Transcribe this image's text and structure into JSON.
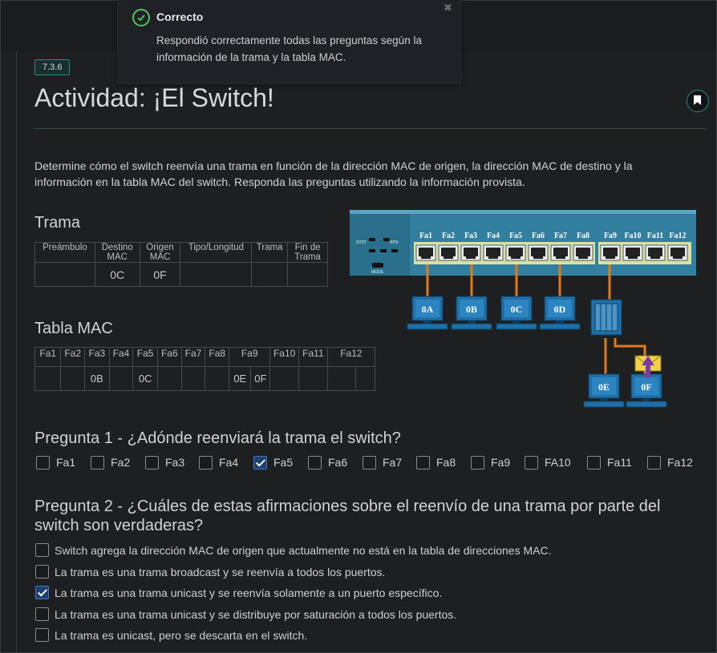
{
  "toast": {
    "title": "Correcto",
    "body": "Respondió correctamente todas las preguntas según la información de la trama y la tabla MAC."
  },
  "badge": "7.3.6",
  "title": "Actividad: ¡El Switch!",
  "description": "Determine cómo el switch reenvía una trama en función de la dirección MAC de origen, la dirección MAC de destino y la información en la tabla MAC del switch. Responda las preguntas utilizando la información provista.",
  "trama": {
    "heading": "Trama",
    "headers": [
      "Preámbulo",
      "Destino MAC",
      "Origen MAC",
      "Tipo/Longitud",
      "Trama",
      "Fin de Trama"
    ],
    "values": [
      "",
      "0C",
      "0F",
      "",
      "",
      ""
    ]
  },
  "mac_table": {
    "heading": "Tabla MAC",
    "headers": [
      "Fa1",
      "Fa2",
      "Fa3",
      "Fa4",
      "Fa5",
      "Fa6",
      "Fa7",
      "Fa8",
      "Fa9",
      "Fa10",
      "Fa11",
      "Fa12"
    ],
    "values": [
      "",
      "",
      "0B",
      "",
      "0C",
      "",
      "",
      "",
      "0E",
      "0F",
      "",
      "",
      "",
      ""
    ]
  },
  "diagram": {
    "ports": [
      "Fa1",
      "Fa2",
      "Fa3",
      "Fa4",
      "Fa5",
      "Fa6",
      "Fa7",
      "Fa8",
      "Fa9",
      "Fa10",
      "Fa11",
      "Fa12"
    ],
    "hosts": [
      "0A",
      "0B",
      "0C",
      "0D",
      "0E",
      "0F"
    ],
    "panel_labels": [
      "SYST",
      "RPS",
      "MODE"
    ],
    "colors": {
      "switch": "#2f7a9a",
      "host": "#1f6fa8",
      "cable": "#e07b1a",
      "arrow": "#7a3aa8",
      "envelope": "#f0d34a"
    }
  },
  "q1": {
    "number": "Pregunta 1",
    "text": "¿Adónde reenviará la trama el switch?",
    "options": [
      {
        "label": "Fa1",
        "checked": false
      },
      {
        "label": "Fa2",
        "checked": false
      },
      {
        "label": "Fa3",
        "checked": false
      },
      {
        "label": "Fa4",
        "checked": false
      },
      {
        "label": "Fa5",
        "checked": true
      },
      {
        "label": "Fa6",
        "checked": false
      },
      {
        "label": "Fa7",
        "checked": false
      },
      {
        "label": "Fa8",
        "checked": false
      },
      {
        "label": "Fa9",
        "checked": false
      },
      {
        "label": "FA10",
        "checked": false
      },
      {
        "label": "Fa11",
        "checked": false
      },
      {
        "label": "Fa12",
        "checked": false
      }
    ]
  },
  "q2": {
    "number": "Pregunta 2",
    "text": "¿Cuáles de estas afirmaciones sobre el reenvío de una trama por parte del switch son verdaderas?",
    "options": [
      {
        "label": "Switch agrega la dirección MAC de origen que actualmente no está en la tabla de direcciones MAC.",
        "checked": false
      },
      {
        "label": "La trama es una trama broadcast y se reenvía a todos los puertos.",
        "checked": false
      },
      {
        "label": "La trama es una trama unicast y se reenvía solamente a un puerto específico.",
        "checked": true
      },
      {
        "label": "La trama es una trama unicast y se distribuye por saturación a todos los puertos.",
        "checked": false
      },
      {
        "label": "La trama es unicast, pero se descarta en el switch.",
        "checked": false
      }
    ]
  }
}
